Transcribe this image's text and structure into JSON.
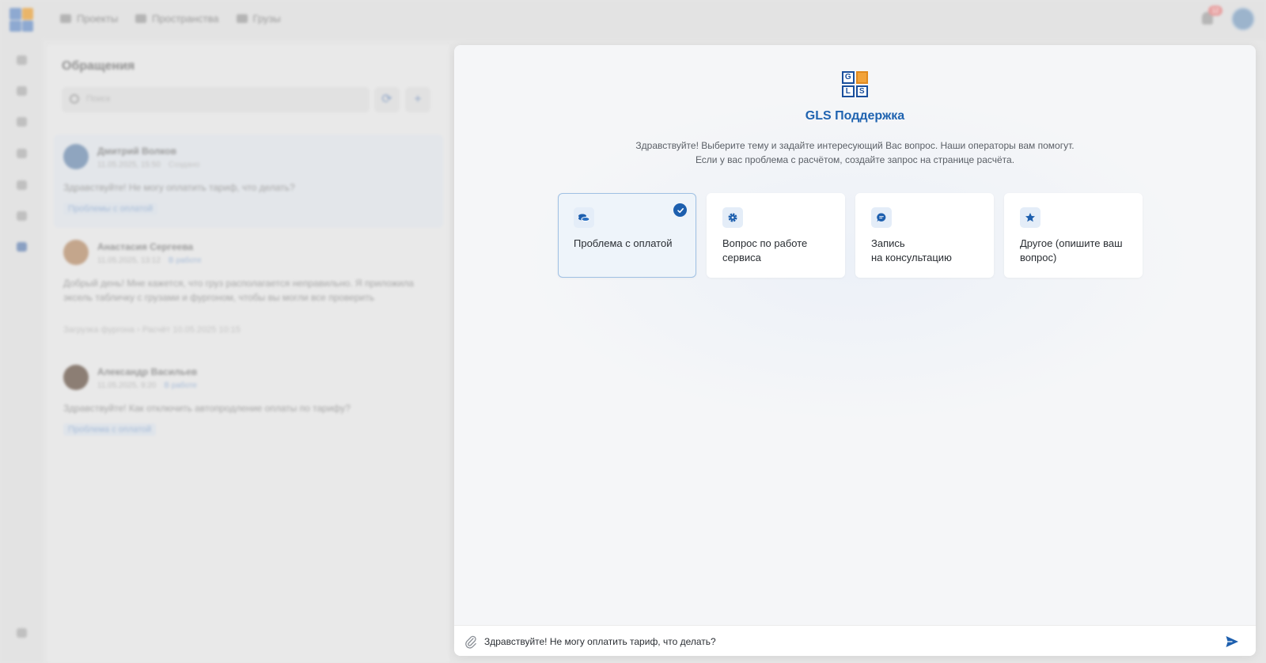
{
  "top_nav": {
    "items": [
      {
        "label": "Проекты",
        "icon": "folder-icon"
      },
      {
        "label": "Пространства",
        "icon": "grid-icon"
      },
      {
        "label": "Грузы",
        "icon": "box-icon"
      }
    ],
    "notification_count": "12"
  },
  "sidebar": {
    "icons": [
      "expand-icon",
      "user-icon",
      "briefcase-icon",
      "image-icon",
      "document-icon",
      "settings-icon",
      "chat-icon",
      "logout-icon"
    ]
  },
  "requests_panel": {
    "title": "Обращения",
    "search_placeholder": "Поиск",
    "add_label": "+",
    "conversations": [
      {
        "name": "Дмитрий Волков",
        "date": "11.05.2025, 15:50",
        "status": "Создано",
        "message": "Здравствуйте! Не могу оплатить тариф, что делать?",
        "tag": "Проблемы с оплатой"
      },
      {
        "name": "Анастасия Сергеева",
        "date": "11.05.2025, 13:12",
        "status": "В работе",
        "message": "Добрый день! Мне кажется, что груз располагается неправильно. Я приложила эксель табличку с грузами и фургоном, чтобы вы могли все проверить",
        "link1": "Загрузка фургона",
        "link2": "Расчёт 10.05.2025 10:15"
      },
      {
        "name": "Александр Васильев",
        "date": "11.05.2025, 9:20",
        "status": "В работе",
        "message": "Здравствуйте! Как отключить автопродление оплаты по тарифу?",
        "tag": "Проблема с оплатой"
      }
    ]
  },
  "support": {
    "logo_letters": [
      "G",
      "",
      "L",
      "S"
    ],
    "title": "GLS Поддержка",
    "subtitle_line1": "Здравствуйте! Выберите тему и задайте интересующий Вас вопрос. Наши операторы вам помогут.",
    "subtitle_line2": "Если у вас проблема с расчётом, создайте запрос на странице расчёта.",
    "topics": [
      {
        "label": "Проблема с оплатой",
        "icon": "coins-icon",
        "selected": true
      },
      {
        "label": "Вопрос по работе\nсервиса",
        "icon": "gear-icon",
        "selected": false
      },
      {
        "label": "Запись\nна консультацию",
        "icon": "chat-bubble-icon",
        "selected": false
      },
      {
        "label": "Другое (опишите ваш\nвопрос)",
        "icon": "star-icon",
        "selected": false
      }
    ],
    "message_value": "Здравствуйте! Не могу оплатить тариф, что делать?",
    "accent_color": "#1d5fae"
  }
}
